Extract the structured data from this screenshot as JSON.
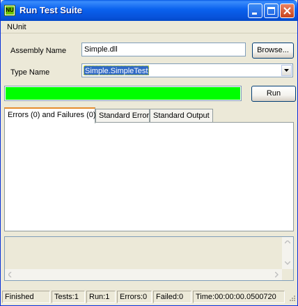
{
  "window": {
    "title": "Run Test Suite",
    "icon_text": "NU"
  },
  "menu": {
    "items": [
      "NUnit"
    ]
  },
  "form": {
    "assembly_label": "Assembly Name",
    "assembly_value": "Simple.dll",
    "browse_label": "Browse...",
    "type_label": "Type Name",
    "type_value": "Simple.SimpleTest",
    "run_label": "Run"
  },
  "progress": {
    "fraction": 1.0,
    "color": "#00ff00"
  },
  "tabs": [
    {
      "label": "Errors (0) and Failures (0)",
      "active": true
    },
    {
      "label": "Standard Error",
      "active": false
    },
    {
      "label": "Standard Output",
      "active": false
    }
  ],
  "status": {
    "state": "Finished",
    "tests": "Tests:1",
    "run": "Run:1",
    "errors": "Errors:0",
    "failed": "Failed:0",
    "time": "Time:00:00:00.0500720"
  },
  "icons": {
    "minimize": "minimize-icon",
    "maximize": "maximize-icon",
    "close": "close-icon",
    "dropdown": "chevron-down-icon"
  }
}
